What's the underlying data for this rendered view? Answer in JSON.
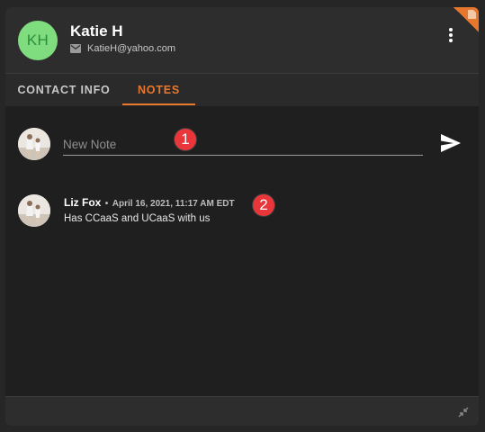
{
  "contact": {
    "initials": "KH",
    "name": "Katie H",
    "email": "KatieH@yahoo.com"
  },
  "tabs": [
    {
      "label": "CONTACT INFO",
      "active": false
    },
    {
      "label": "NOTES",
      "active": true
    }
  ],
  "composer": {
    "placeholder": "New Note"
  },
  "notes": [
    {
      "author": "Liz Fox",
      "separator": "•",
      "timestamp": "April 16, 2021, 11:17 AM EDT",
      "text": "Has CCaaS and UCaaS with us"
    }
  ],
  "markers": [
    "1",
    "2"
  ],
  "icons": {
    "email": "mail-icon",
    "more": "more-vert-icon",
    "send": "send-icon",
    "collapse": "collapse-icon",
    "badge": "document-icon"
  },
  "colors": {
    "accent": "#e8772e",
    "avatar_bg": "#7fdc7f",
    "marker": "#e8363a"
  }
}
